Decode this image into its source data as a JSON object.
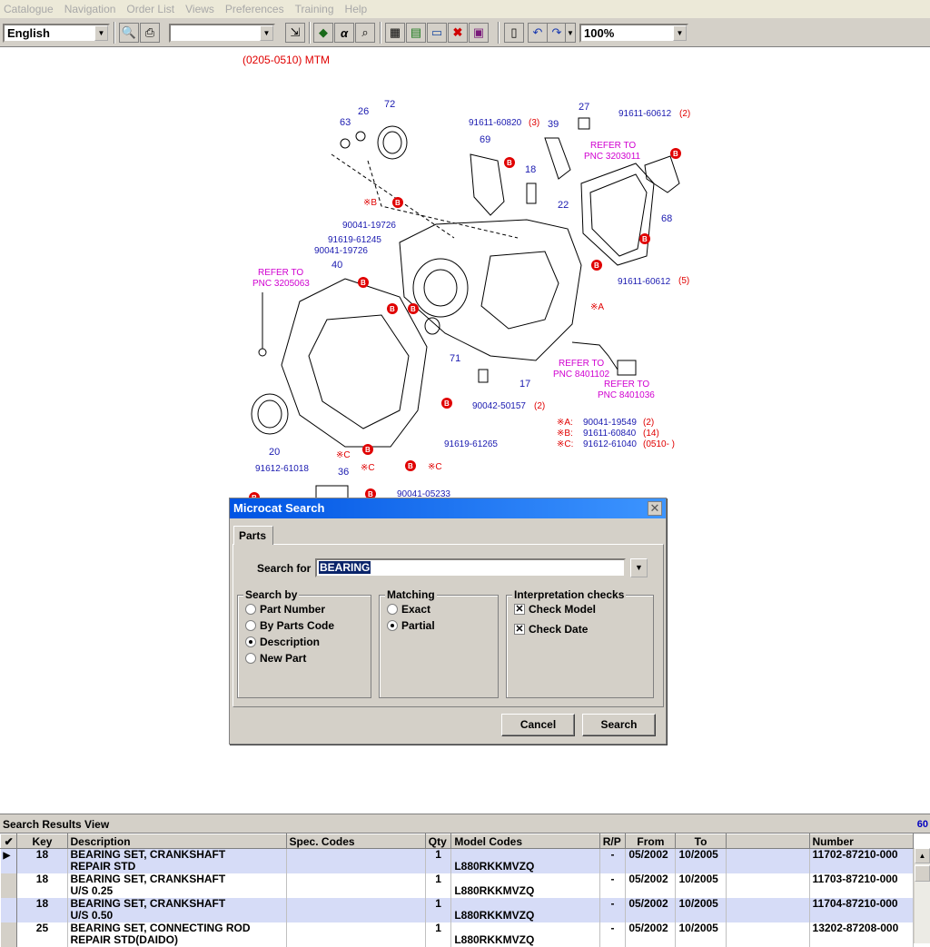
{
  "menu": [
    "Catalogue",
    "Navigation",
    "Order List",
    "Views",
    "Preferences",
    "Training",
    "Help"
  ],
  "toolbar": {
    "language": "English",
    "empty_combo": "",
    "zoom": "100%",
    "icons": [
      "preview-icon",
      "print-icon",
      "select-icon",
      "paint-icon",
      "alpha-icon",
      "find-icon",
      "frame-icon",
      "book-icon",
      "monitor-icon",
      "close-red-icon",
      "manual-icon",
      "note-icon",
      "undo-icon",
      "redo-icon"
    ]
  },
  "diagram": {
    "title": "(0205-0510) MTM",
    "labels": {
      "l63": "63",
      "l26": "26",
      "l72": "72",
      "l91611_60820": "91611-60820",
      "l3": "(3)",
      "l39": "39",
      "l27": "27",
      "l91611_60612a": "91611-60612",
      "l2a": "(2)",
      "l69": "69",
      "l18": "18",
      "refer_3203011_a": "REFER TO",
      "refer_3203011_b": "PNC 3203011",
      "lxb": "※B",
      "l22": "22",
      "l68": "68",
      "l90041_19726a": "90041-19726",
      "l91619_61245": "91619-61245",
      "l90041_19726b": "90041-19726",
      "l40": "40",
      "refer_3205063_a": "REFER TO",
      "refer_3205063_b": "PNC 3205063",
      "l91611_60612b": "91611-60612",
      "l5": "(5)",
      "lxa": "※A",
      "l71": "71",
      "refer_8401102_a": "REFER TO",
      "refer_8401102_b": "PNC 8401102",
      "refer_8401036_a": "REFER TO",
      "refer_8401036_b": "PNC 8401036",
      "l17": "17",
      "l90042_50157": "90042-50157",
      "l2b": "(2)",
      "l20": "20",
      "l91619_61265": "91619-61265",
      "lxc1": "※C",
      "lxc2": "※C",
      "lxc3": "※C",
      "l91612_61018": "91612-61018",
      "l36": "36",
      "l90041_05233": "90041-05233",
      "leg_a": "※A:",
      "leg_a_num": "90041-19549",
      "leg_a_q": "(2)",
      "leg_b": "※B:",
      "leg_b_num": "91611-60840",
      "leg_b_q": "(14)",
      "leg_c": "※C:",
      "leg_c_num": "91612-61040",
      "leg_c_q": "(0510-   )"
    }
  },
  "dialog": {
    "title": "Microcat Search",
    "tab": "Parts",
    "search_label": "Search for",
    "search_value": "BEARING",
    "search_by": {
      "title": "Search by",
      "options": [
        "Part Number",
        "By Parts Code",
        "Description",
        "New Part"
      ],
      "selected": "Description"
    },
    "matching": {
      "title": "Matching",
      "options": [
        "Exact",
        "Partial"
      ],
      "selected": "Partial"
    },
    "checks": {
      "title": "Interpretation checks",
      "items": [
        {
          "label": "Check Model",
          "checked": true
        },
        {
          "label": "Check Date",
          "checked": true
        }
      ]
    },
    "cancel": "Cancel",
    "search": "Search"
  },
  "results": {
    "title": "Search Results View",
    "count": "60",
    "columns": [
      "Key",
      "Description",
      "Spec. Codes",
      "Qty",
      "Model Codes",
      "R/P",
      "From",
      "To",
      "",
      "Number"
    ],
    "rows": [
      {
        "key": "18",
        "desc1": "BEARING SET, CRANKSHAFT",
        "desc2": "REPAIR STD",
        "spec": "",
        "qty": "1",
        "model": "L880RKKMVZQ",
        "rp": "-",
        "from": "05/2002",
        "to": "10/2005",
        "blank": "",
        "number": "11702-87210-000"
      },
      {
        "key": "18",
        "desc1": "BEARING SET, CRANKSHAFT",
        "desc2": "U/S 0.25",
        "spec": "",
        "qty": "1",
        "model": "L880RKKMVZQ",
        "rp": "-",
        "from": "05/2002",
        "to": "10/2005",
        "blank": "",
        "number": "11703-87210-000"
      },
      {
        "key": "18",
        "desc1": "BEARING SET, CRANKSHAFT",
        "desc2": "U/S 0.50",
        "spec": "",
        "qty": "1",
        "model": "L880RKKMVZQ",
        "rp": "-",
        "from": "05/2002",
        "to": "10/2005",
        "blank": "",
        "number": "11704-87210-000"
      },
      {
        "key": "25",
        "desc1": "BEARING SET, CONNECTING ROD",
        "desc2": "REPAIR STD(DAIDO)",
        "spec": "",
        "qty": "1",
        "model": "L880RKKMVZQ",
        "rp": "-",
        "from": "05/2002",
        "to": "10/2005",
        "blank": "",
        "number": "13202-87208-000"
      }
    ]
  }
}
